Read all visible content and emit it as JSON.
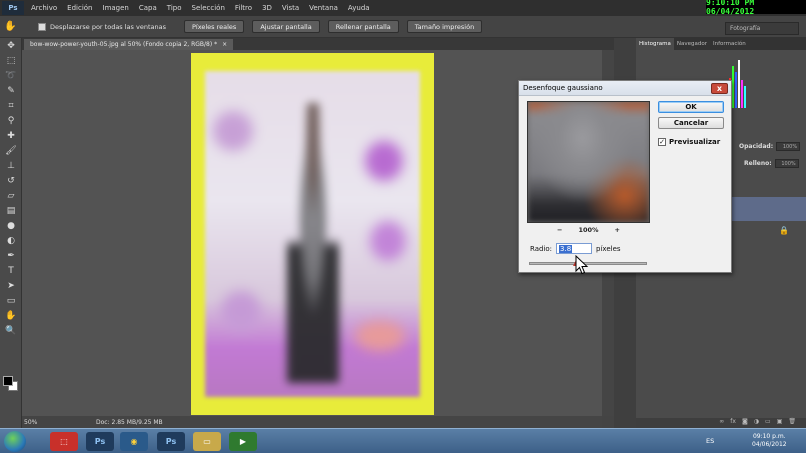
{
  "menubar": {
    "logo": "Ps",
    "items": [
      "Archivo",
      "Edición",
      "Imagen",
      "Capa",
      "Tipo",
      "Selección",
      "Filtro",
      "3D",
      "Vista",
      "Ventana",
      "Ayuda"
    ],
    "clock": "9:10:10 PM 06/04/2012"
  },
  "options": {
    "scroll_all_label": "Desplazarse por todas las ventanas",
    "buttons": [
      "Píxeles reales",
      "Ajustar pantalla",
      "Rellenar pantalla",
      "Tamaño impresión"
    ],
    "workspace": "Fotografía"
  },
  "document": {
    "tab_title": "bow-wow-power-youth-05.jpg al 50% (Fondo copia 2, RGB/8) *",
    "tab_close": "×",
    "zoom": "50%",
    "doc_info": "Doc: 2.85 MB/9.25 MB"
  },
  "panels": {
    "tabs": [
      "Histograma",
      "Navegador",
      "Información"
    ],
    "opacity_label": "Opacidad:",
    "opacity_value": "100%",
    "fill_label": "Relleno:",
    "fill_value": "100%"
  },
  "dialog": {
    "title": "Desenfoque gaussiano",
    "close": "x",
    "ok": "OK",
    "cancel": "Cancelar",
    "preview_label": "Previsualizar",
    "preview_checked": "✓",
    "zoom_minus": "−",
    "zoom_value": "100%",
    "zoom_plus": "+",
    "radius_label": "Radio:",
    "radius_value": "3.8",
    "radius_unit": "píxeles"
  },
  "taskbar": {
    "lang": "ES",
    "time": "09:10 p.m.",
    "date": "04/06/2012",
    "ps_label": "Ps"
  }
}
